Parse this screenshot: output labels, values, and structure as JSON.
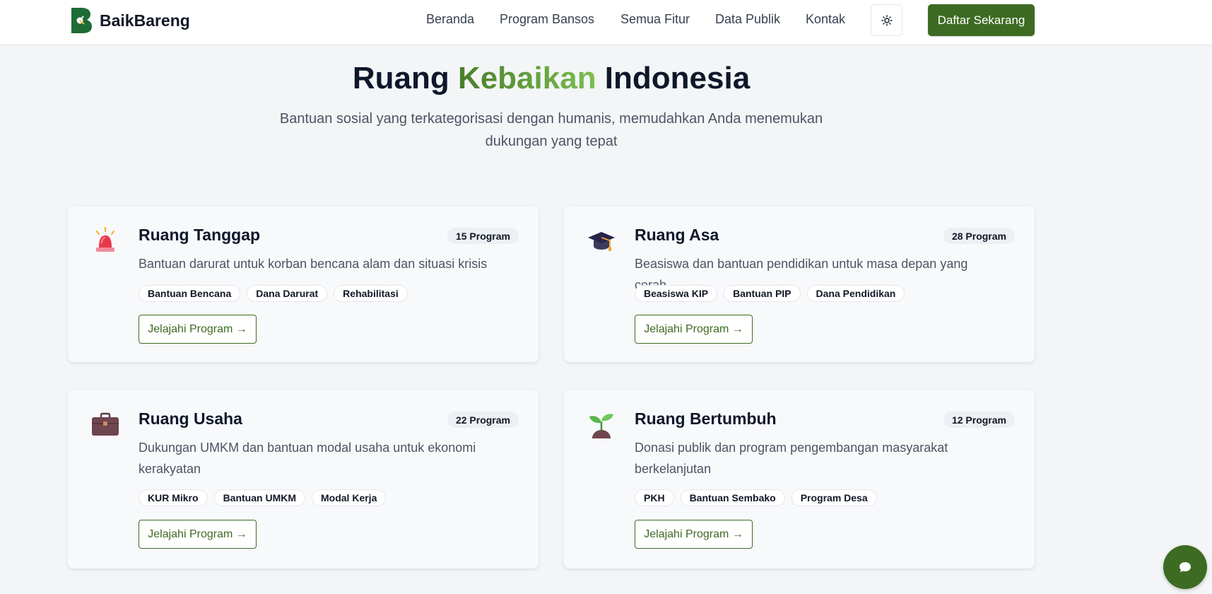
{
  "navbar": {
    "brand": "BaikBareng",
    "links": [
      "Beranda",
      "Program Bansos",
      "Semua Fitur",
      "Data Publik",
      "Kontak"
    ],
    "cta": "Daftar Sekarang"
  },
  "hero": {
    "title_before": "Ruang ",
    "title_accent": "Kebaikan",
    "title_after": " Indonesia",
    "subtitle": "Bantuan sosial yang terkategorisasi dengan humanis, memudahkan Anda menemukan dukungan yang tepat"
  },
  "cards": [
    {
      "icon": "siren-icon",
      "title": "Ruang Tanggap",
      "count": "15 Program",
      "description": "Bantuan darurat untuk korban bencana alam dan situasi krisis",
      "tags": [
        "Bantuan Bencana",
        "Dana Darurat",
        "Rehabilitasi"
      ],
      "button": "Jelajahi Program →"
    },
    {
      "icon": "graduation-cap-icon",
      "title": "Ruang Asa",
      "count": "28 Program",
      "description": "Beasiswa dan bantuan pendidikan untuk masa depan yang cerah",
      "tags": [
        "Beasiswa KIP",
        "Bantuan PIP",
        "Dana Pendidikan"
      ],
      "button": "Jelajahi Program →"
    },
    {
      "icon": "briefcase-icon",
      "title": "Ruang Usaha",
      "count": "22 Program",
      "description": "Dukungan UMKM dan bantuan modal usaha untuk ekonomi kerakyatan",
      "tags": [
        "KUR Mikro",
        "Bantuan UMKM",
        "Modal Kerja"
      ],
      "button": "Jelajahi Program →"
    },
    {
      "icon": "seedling-icon",
      "title": "Ruang Bertumbuh",
      "count": "12 Program",
      "description": "Donasi publik dan program pengembangan masyarakat berkelanjutan",
      "tags": [
        "PKH",
        "Bantuan Sembako",
        "Program Desa"
      ],
      "button": "Jelajahi Program →"
    }
  ],
  "colors": {
    "primary": "#3d6b22",
    "accent_light": "#7bbf4f",
    "background": "#f3f5f7",
    "card": "#f8f9fb"
  }
}
